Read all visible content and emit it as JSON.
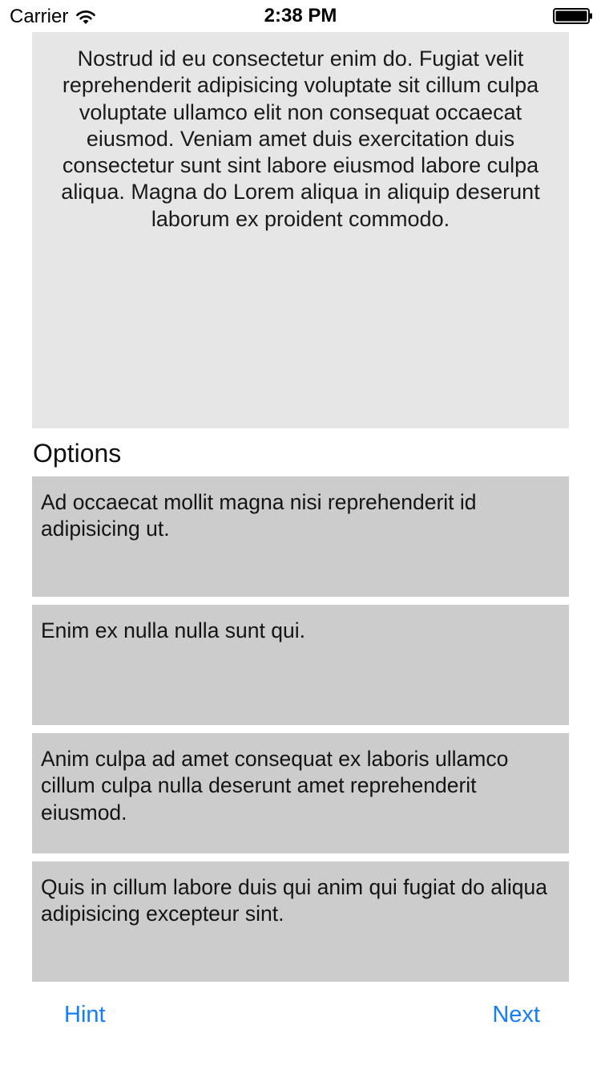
{
  "status_bar": {
    "carrier": "Carrier",
    "time": "2:38 PM",
    "icons": [
      "wifi-icon",
      "battery-icon"
    ]
  },
  "question": {
    "text": "Nostrud id eu consectetur enim do. Fugiat velit reprehenderit adipisicing voluptate sit cillum culpa voluptate ullamco elit non consequat occaecat eiusmod. Veniam amet duis exercitation duis consectetur sunt sint labore eiusmod labore culpa aliqua. Magna do Lorem aliqua in aliquip deserunt laborum ex proident commodo."
  },
  "options": {
    "header": "Options",
    "items": [
      {
        "text": "Ad occaecat mollit magna nisi reprehenderit id adipisicing ut."
      },
      {
        "text": "Enim ex nulla nulla sunt qui."
      },
      {
        "text": "Anim culpa ad amet consequat ex laboris ullamco cillum culpa nulla deserunt amet reprehenderit eiusmod."
      },
      {
        "text": "Quis in cillum labore duis qui anim qui fugiat do aliqua adipisicing excepteur sint."
      }
    ]
  },
  "footer": {
    "hint_label": "Hint",
    "next_label": "Next"
  },
  "colors": {
    "accent": "#147efb",
    "question_bg": "#e6e6e6",
    "option_bg": "#cccccc"
  }
}
